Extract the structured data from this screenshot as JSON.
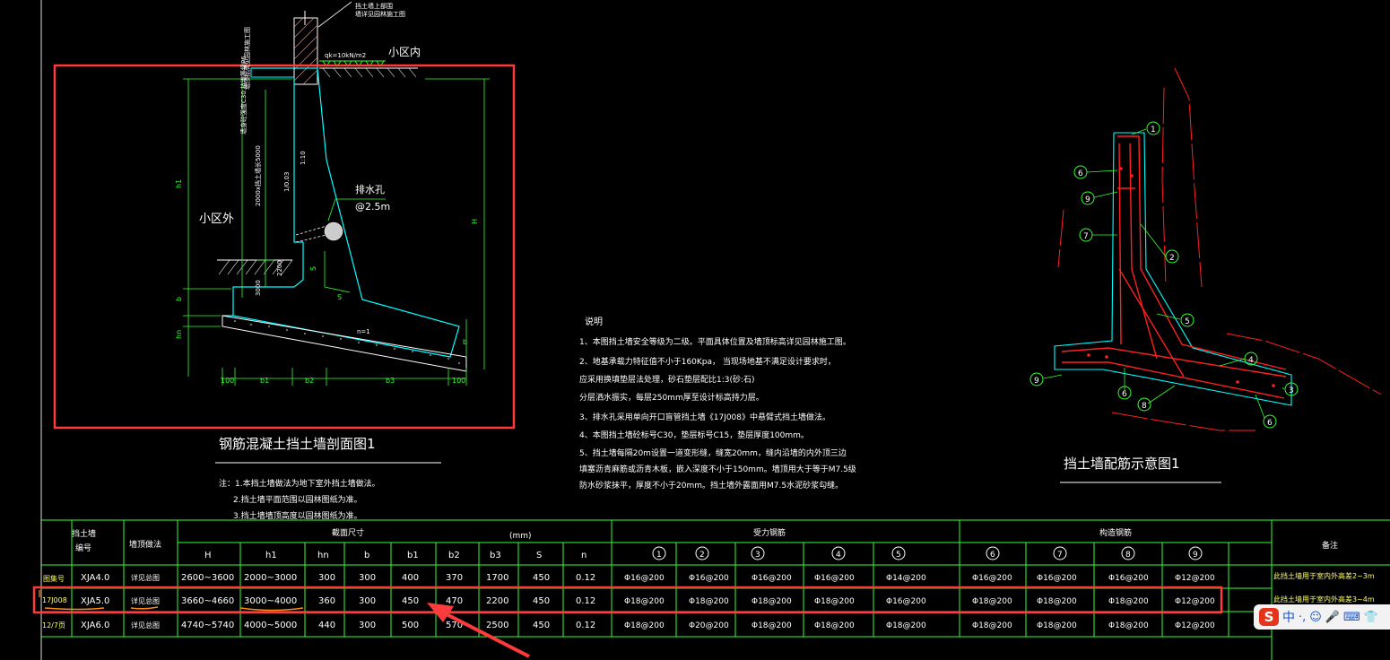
{
  "section_view": {
    "title": "钢筋混凝土挡土墙剖面图1",
    "label_inside": "小区内",
    "label_outside": "小区外",
    "load": "qk=10kN/m2",
    "note_top_a": "挡土墙上部围",
    "note_top_b": "墙详见园林施工图",
    "drain_a": "排水孔",
    "drain_b": "@2.5m",
    "slope_top": "1:10",
    "slope_bottom": "n=1",
    "dims": [
      "100",
      "b1",
      "b2",
      "b3",
      "100",
      "h1",
      "H",
      "hn",
      "b",
      "S",
      "S",
      "b",
      "2200",
      "3000",
      "200",
      "h"
    ],
    "vertical_texts": [
      "墙顶标高见园林施工图",
      "2000x挡土墙长5000",
      "1/0.03",
      "墙身砼强度C30.抗渗等级P6"
    ]
  },
  "notes": {
    "heading": "说明",
    "lines": [
      "1、本图挡土墙安全等级为二级。平面具体位置及墙顶标高详见园林施工图。",
      "2、地基承载力特征值不小于160Kpa，  当现场地基不满足设计要求时，",
      "     应采用换填垫层法处理，砂石垫层配比1:3(砂:石)",
      "     分层洒水振实，每层250mm厚至设计标高持力层。",
      "3、排水孔采用单向开口盲管挡土墙《17J008》中悬臂式挡土墙做法。",
      "4、本图挡土墙砼标号C30，垫层标号C15，垫层厚度100mm。",
      "5、挡土墙每隔20m设置一道变形缝，缝宽20mm，缝内沿墙的内外顶三边",
      "填塞沥青麻筋或沥青木板，嵌入深度不小于150mm。墙顶用大于等于M7.5级",
      "防水砂浆抹平，厚度不小于20mm。挡土墙外露面用M7.5水泥砂浆勾缝。"
    ],
    "extra": [
      "注：1.本挡土墙做法为地下室外挡土墙做法。",
      "2.挡土墙平面范围以园林图纸为准。",
      "3.挡土墙墙顶高度以园林图纸为准。"
    ]
  },
  "rebar_view": {
    "title": "挡土墙配筋示意图1",
    "markers": [
      "1",
      "2",
      "3",
      "4",
      "5",
      "6",
      "6",
      "6",
      "7",
      "8",
      "9",
      "9"
    ]
  },
  "table": {
    "h_wall_a": "挡土墙",
    "h_wall_b": "编号",
    "h_detail": "墙顶做法",
    "h_section": "截面尺寸",
    "h_unit": "(mm)",
    "h_main": "受力钢筋",
    "h_construct": "构造钢筋",
    "h_remark": "备注",
    "sub_cols": [
      "H",
      "h1",
      "hn",
      "b",
      "b1",
      "b2",
      "b3",
      "S",
      "n"
    ],
    "circle_cols": [
      "1",
      "2",
      "3",
      "4",
      "5",
      "6",
      "7",
      "8",
      "9"
    ],
    "left_notes": [
      "图集号",
      "17J008",
      "12/7页"
    ],
    "rows": [
      {
        "id": "XJA4.0",
        "detail": "详见总图",
        "dims": [
          "2600~3600",
          "2000~3000",
          "300",
          "300",
          "400",
          "370",
          "1700",
          "450",
          "0.12"
        ],
        "bars": [
          "Φ16@200",
          "Φ16@200",
          "Φ16@200",
          "Φ16@200",
          "Φ14@200",
          "Φ16@200",
          "Φ16@200",
          "Φ16@200",
          "Φ12@200"
        ],
        "remark": "此挡土墙用于室内外高差2~3m"
      },
      {
        "id": "XJA5.0",
        "detail": "详见总图",
        "dims": [
          "3660~4660",
          "3000~4000",
          "360",
          "300",
          "450",
          "470",
          "2200",
          "450",
          "0.12"
        ],
        "bars": [
          "Φ18@200",
          "Φ18@200",
          "Φ18@200",
          "Φ18@200",
          "Φ16@200",
          "Φ18@200",
          "Φ18@200",
          "Φ18@200",
          "Φ12@200"
        ],
        "remark": "此挡土墙用于室内外高差3~4m"
      },
      {
        "id": "XJA6.0",
        "detail": "详见总图",
        "dims": [
          "4740~5740",
          "4000~5000",
          "440",
          "300",
          "500",
          "570",
          "2500",
          "450",
          "0.12"
        ],
        "bars": [
          "Φ18@200",
          "Φ20@200",
          "Φ18@200",
          "Φ18@200",
          "Φ18@200",
          "Φ18@200",
          "Φ18@200",
          "Φ18@200",
          "Φ12@200"
        ],
        "remark": "此挡土墙用于室内外高差4~5m"
      }
    ]
  },
  "ime": {
    "logo": "S",
    "lang": "中",
    "icons": [
      "·,",
      "☺",
      "🎤",
      "⌨",
      "👕"
    ]
  },
  "colors": {
    "background": "#000000",
    "dim": "#33ff33",
    "outline": "#00ffff",
    "highlight": "#ff3b3b",
    "rebar": "#ff2020",
    "text": "#ffffff",
    "label": "#ffff66"
  }
}
